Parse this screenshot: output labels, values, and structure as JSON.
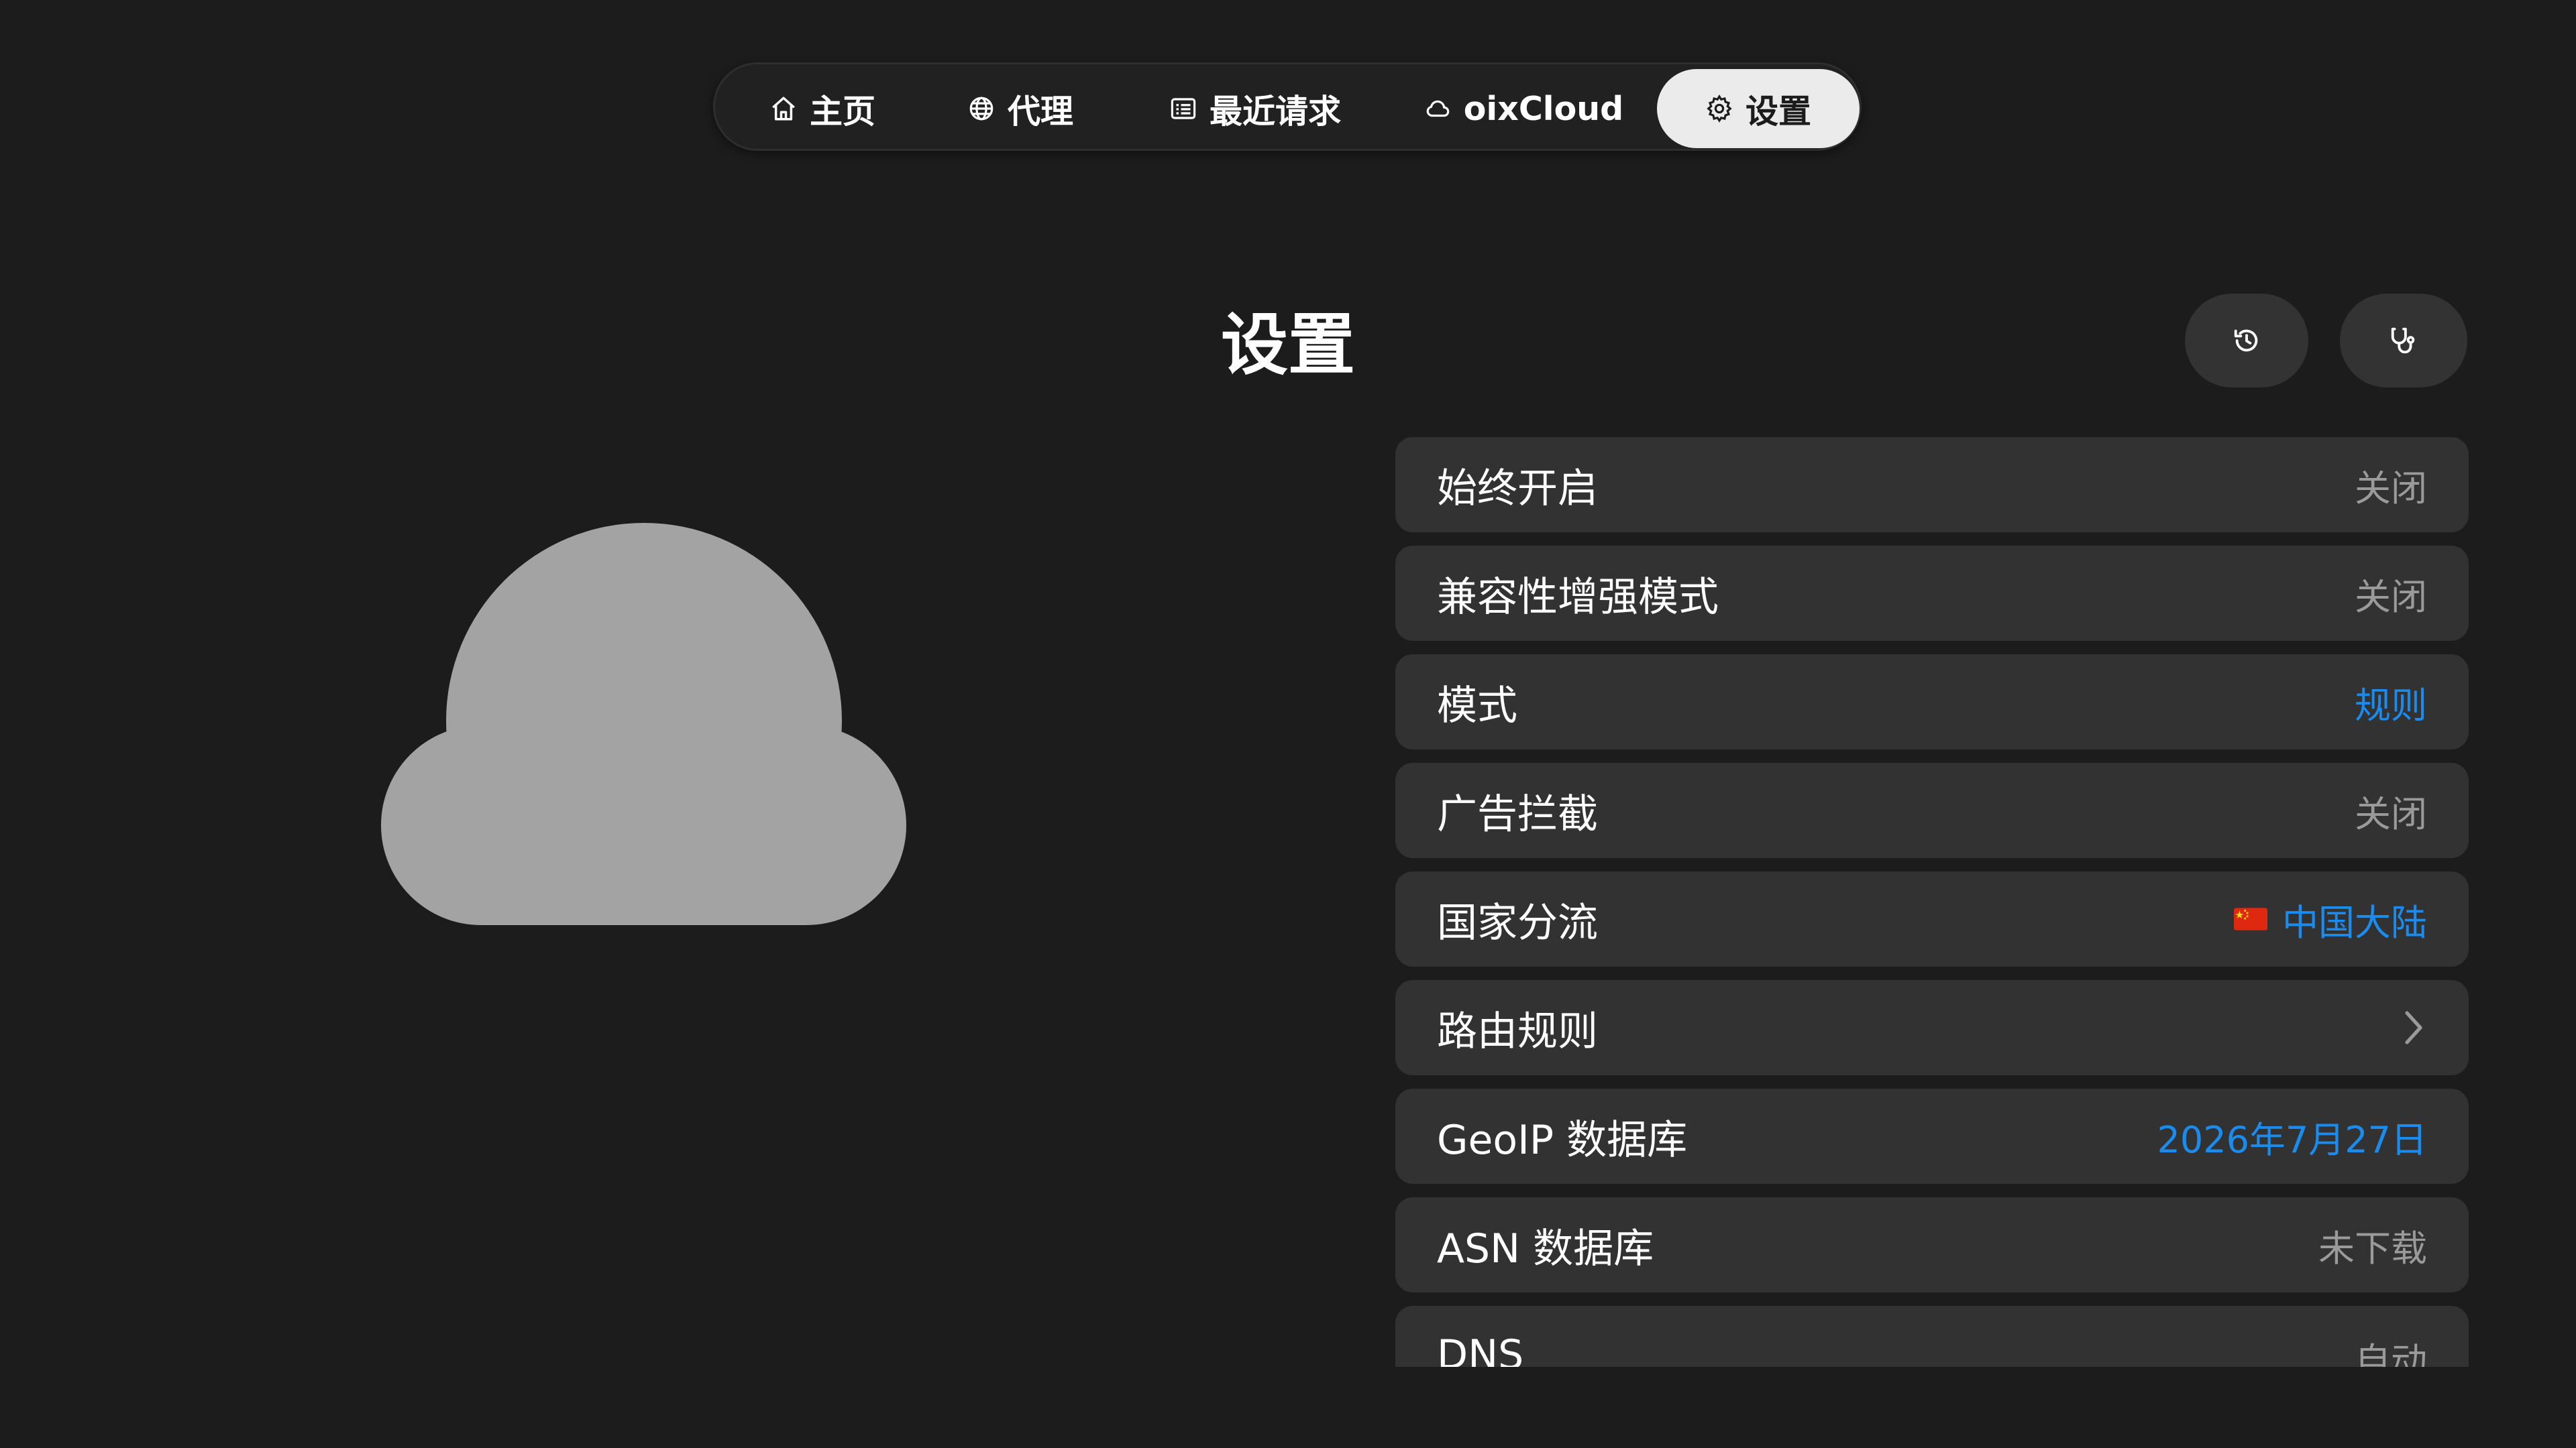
{
  "tabs": [
    {
      "label": "主页",
      "icon": "home-icon"
    },
    {
      "label": "代理",
      "icon": "globe-icon"
    },
    {
      "label": "最近请求",
      "icon": "list-icon"
    },
    {
      "label": "oixCloud",
      "icon": "cloud-icon"
    },
    {
      "label": "设置",
      "icon": "gear-icon",
      "active": true
    }
  ],
  "page": {
    "title": "设置"
  },
  "actions": {
    "history_icon": "history-icon",
    "diagnose_icon": "stethoscope-icon"
  },
  "settings": [
    {
      "label": "始终开启",
      "value": "关闭"
    },
    {
      "label": "兼容性增强模式",
      "value": "关闭"
    },
    {
      "label": "模式",
      "value": "规则"
    },
    {
      "label": "广告拦截",
      "value": "关闭"
    },
    {
      "label": "国家分流",
      "value": "中国大陆",
      "flag": "china-flag-icon"
    },
    {
      "label": "路由规则",
      "value": "",
      "icon": "chevron-right-icon"
    },
    {
      "label": "GeoIP 数据库",
      "value": "2026年7月27日"
    },
    {
      "label": "ASN 数据库",
      "value": "未下载"
    },
    {
      "label": "DNS",
      "value": "自动"
    }
  ],
  "colors": {
    "background": "#1c1c1c",
    "row_background": "#323232",
    "accent": "#1a8cf0",
    "muted_text": "#9a9a9a",
    "cloud": "#a3a3a3"
  }
}
